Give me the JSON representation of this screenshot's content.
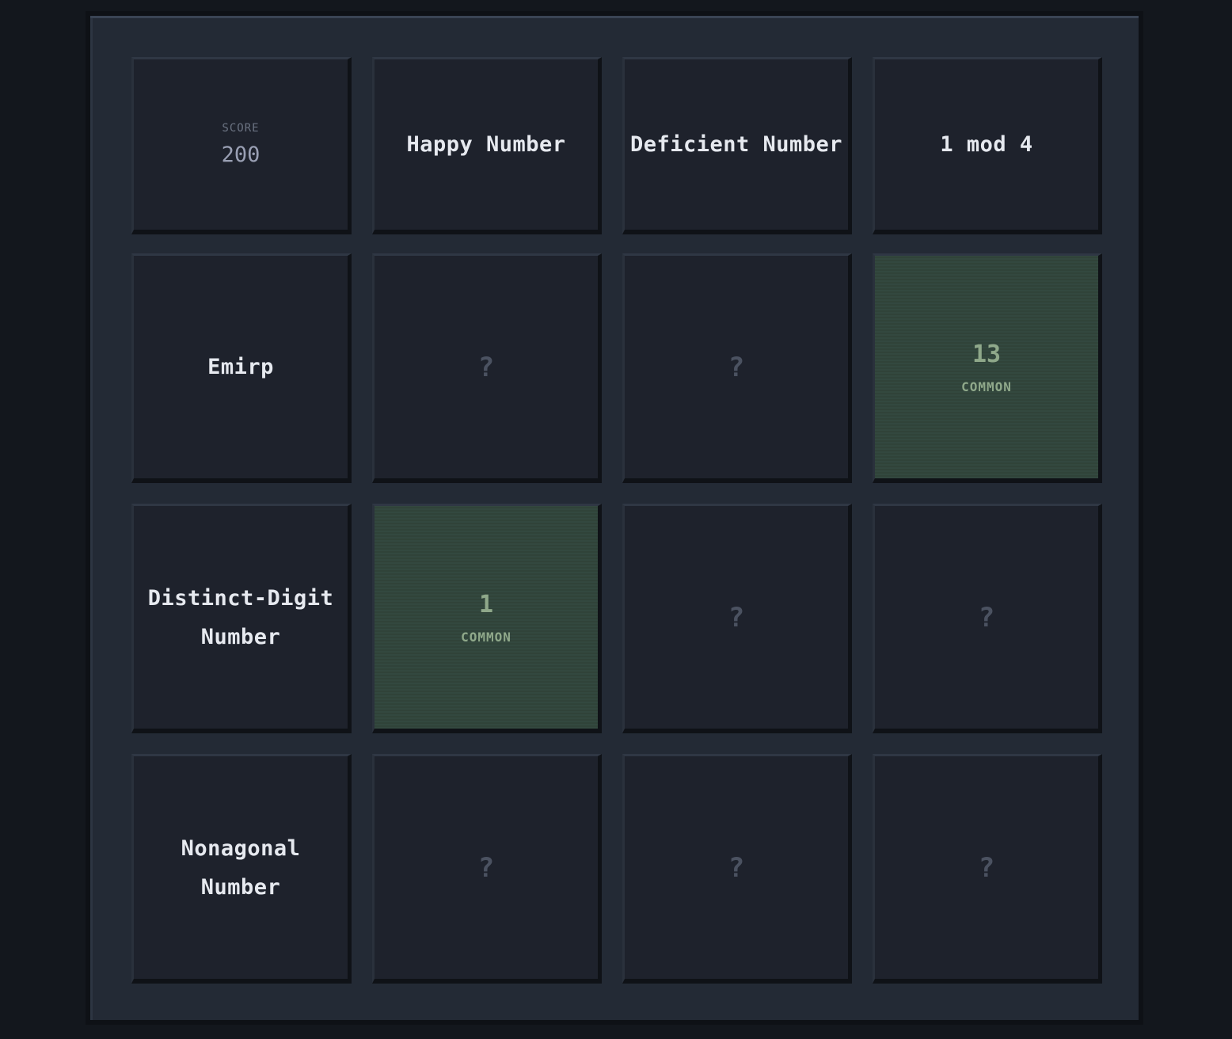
{
  "score": {
    "label": "SCORE",
    "value": "200"
  },
  "columns": [
    "Happy Number",
    "Deficient Number",
    "1 mod 4"
  ],
  "rows": [
    {
      "label": "Emirp",
      "cells": [
        "?",
        "?",
        {
          "number": "13",
          "rarity": "COMMON"
        }
      ]
    },
    {
      "label": "Distinct-Digit Number",
      "cells": [
        {
          "number": "1",
          "rarity": "COMMON"
        },
        "?",
        "?"
      ]
    },
    {
      "label": "Nonagonal Number",
      "cells": [
        "?",
        "?",
        "?"
      ]
    }
  ],
  "labels": {
    "r0": "Emirp",
    "r1a": "Distinct-Digit",
    "r1b": "Number",
    "r2a": "Nonagonal",
    "r2b": "Number",
    "unknown": "?",
    "c02_num": "13",
    "c02_rarity": "COMMON",
    "c10_num": "1",
    "c10_rarity": "COMMON"
  },
  "colors": {
    "board": "#232a35",
    "cell": "#1e222c",
    "found_cell": "#33483f",
    "found_text": "#8fa88a"
  }
}
